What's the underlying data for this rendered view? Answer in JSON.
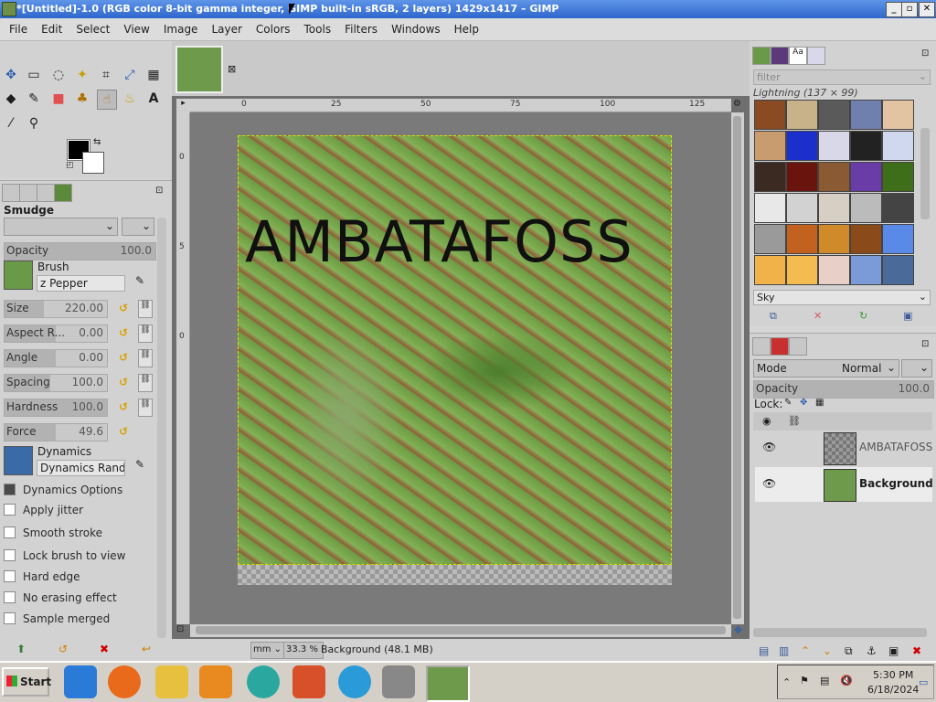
{
  "titlebar": {
    "title": "*[Untitled]-1.0 (RGB color 8-bit gamma integer, GIMP built-in sRGB, 2 layers) 1429x1417 – GIMP"
  },
  "menu": [
    "File",
    "Edit",
    "Select",
    "View",
    "Image",
    "Layer",
    "Colors",
    "Tools",
    "Filters",
    "Windows",
    "Help"
  ],
  "tool_options": {
    "title": "Smudge",
    "opacity": {
      "label": "Opacity",
      "value": "100.0"
    },
    "brush_label": "Brush",
    "brush_name": "z Pepper",
    "size": {
      "label": "Size",
      "value": "220.00"
    },
    "aspect": {
      "label": "Aspect R...",
      "value": "0.00"
    },
    "angle": {
      "label": "Angle",
      "value": "0.00"
    },
    "spacing": {
      "label": "Spacing",
      "value": "100.0"
    },
    "hardness": {
      "label": "Hardness",
      "value": "100.0"
    },
    "force": {
      "label": "Force",
      "value": "49.6"
    },
    "dynamics_label": "Dynamics",
    "dynamics_name": "Dynamics Rando",
    "checks": [
      {
        "label": "Dynamics Options",
        "on": true
      },
      {
        "label": "Apply jitter",
        "on": false
      },
      {
        "label": "Smooth stroke",
        "on": false
      },
      {
        "label": "Lock brush to view",
        "on": false
      },
      {
        "label": "Hard edge",
        "on": false
      },
      {
        "label": "No erasing effect",
        "on": false
      },
      {
        "label": "Sample merged",
        "on": false
      }
    ]
  },
  "canvas": {
    "text_layer": "AMBATAFOSS",
    "ruler_h": [
      "0",
      "25",
      "50",
      "75",
      "100",
      "125"
    ],
    "ruler_v": [
      "0",
      "5",
      "0"
    ]
  },
  "statusbar": {
    "unit": "mm",
    "zoom": "33.3 %",
    "info": "Background (48.1 MB)"
  },
  "patterns": {
    "filter_placeholder": "filter",
    "selected": "Lightning (137 × 99)",
    "current": "Sky",
    "swatch_colors": [
      "#8a4a22",
      "#c7b28a",
      "#5a5a5a",
      "#6f7fae",
      "#e2c3a2",
      "#c89c6e",
      "#1a2fcc",
      "#d8d8e8",
      "#222222",
      "#d0d8f0",
      "#3a2a22",
      "#6a140e",
      "#8a5a32",
      "#6a3ca8",
      "#3e6e1a",
      "#e8e8e8",
      "#d2d2d2",
      "#d8cfc4",
      "#bbbbbb",
      "#444444",
      "#9a9a9a",
      "#c2621e",
      "#d08a2a",
      "#8a4a1a",
      "#5a8ae8",
      "#f2b24a",
      "#f4bb50",
      "#e8d0c8",
      "#7a9ad8",
      "#4a6a9a"
    ]
  },
  "layers": {
    "mode_label": "Mode",
    "mode_value": "Normal",
    "opacity_label": "Opacity",
    "opacity_value": "100.0",
    "lock_label": "Lock:",
    "items": [
      {
        "name": "AMBATAFOSS",
        "bold": false
      },
      {
        "name": "Background",
        "bold": true
      }
    ]
  },
  "taskbar": {
    "start": "Start",
    "time": "5:30 PM",
    "date": "6/18/2024"
  }
}
